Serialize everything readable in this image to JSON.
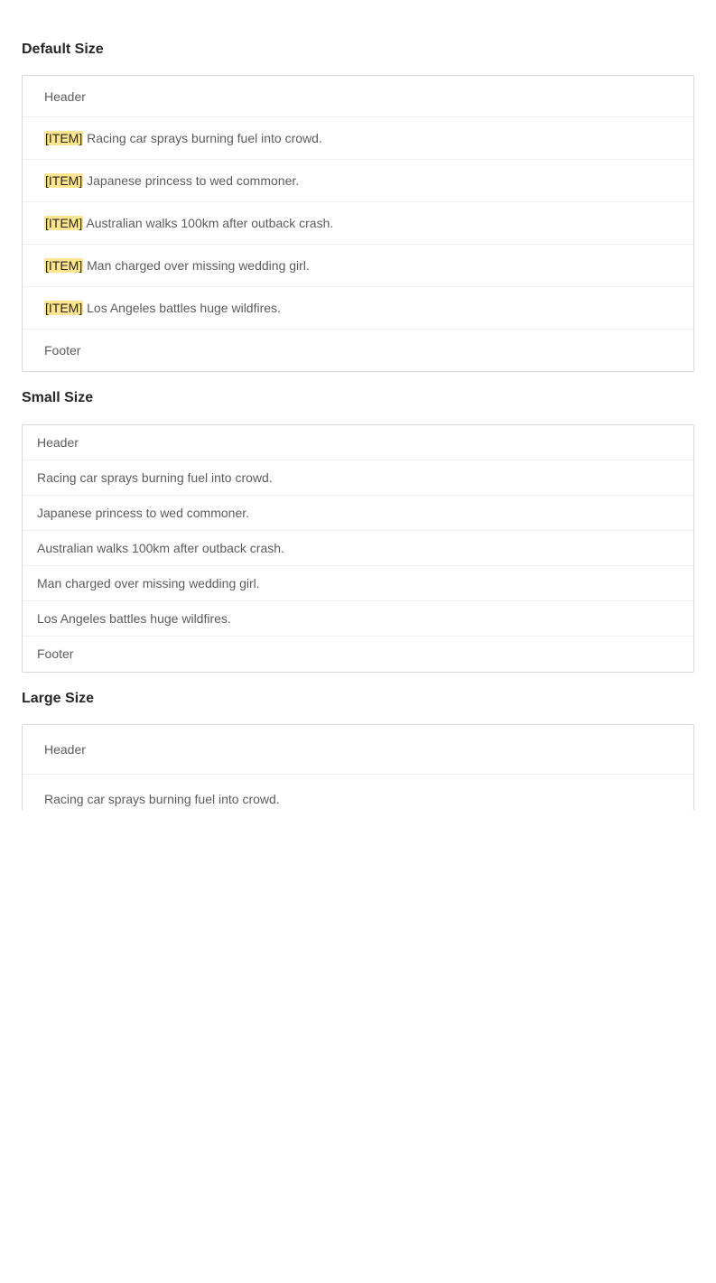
{
  "sections": {
    "default": {
      "title": "Default Size",
      "header": "Header",
      "footer": "Footer",
      "tag": "[ITEM]",
      "items": [
        "Racing car sprays burning fuel into crowd.",
        "Japanese princess to wed commoner.",
        "Australian walks 100km after outback crash.",
        "Man charged over missing wedding girl.",
        "Los Angeles battles huge wildfires."
      ]
    },
    "small": {
      "title": "Small Size",
      "header": "Header",
      "footer": "Footer",
      "items": [
        "Racing car sprays burning fuel into crowd.",
        "Japanese princess to wed commoner.",
        "Australian walks 100km after outback crash.",
        "Man charged over missing wedding girl.",
        "Los Angeles battles huge wildfires."
      ]
    },
    "large": {
      "title": "Large Size",
      "header": "Header",
      "items": [
        "Racing car sprays burning fuel into crowd."
      ]
    }
  },
  "colors": {
    "tag_background": "#ffe58f",
    "border": "#d9d9d9",
    "divider": "#f0f0f0"
  }
}
